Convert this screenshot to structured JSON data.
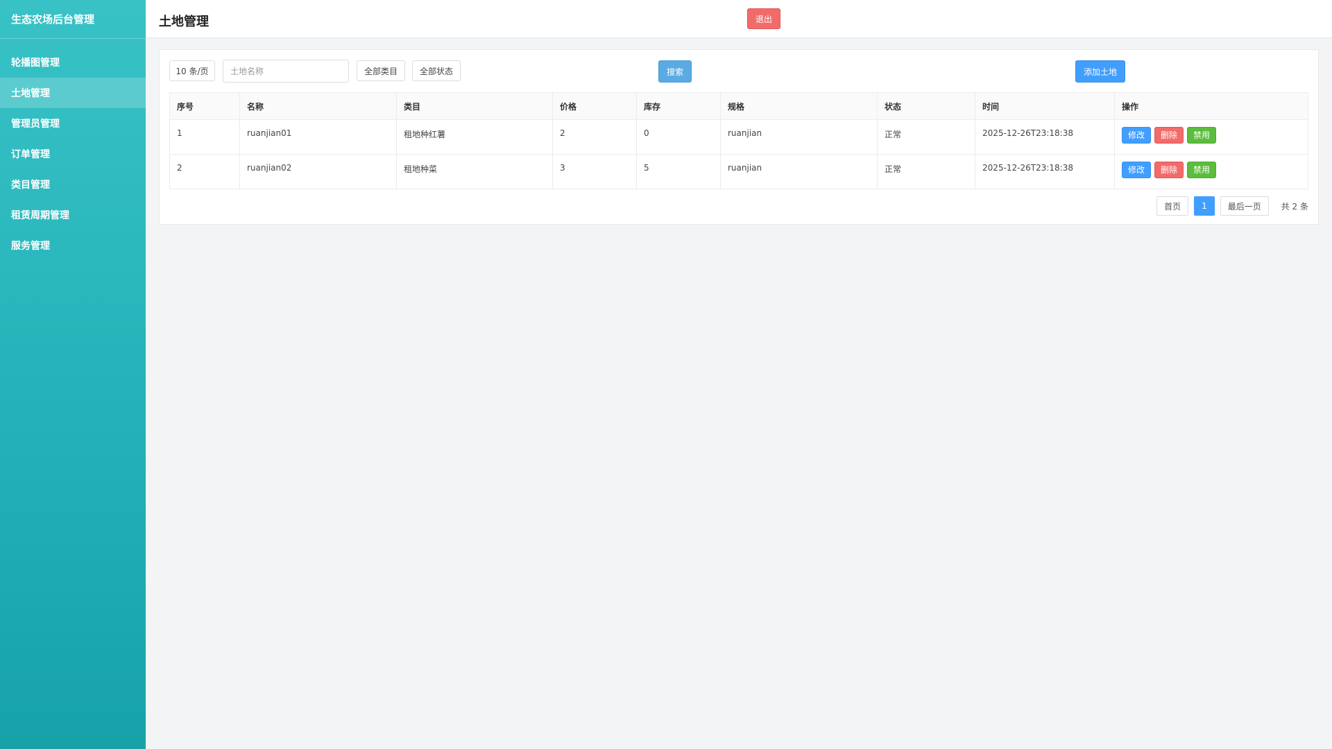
{
  "sidebar": {
    "title": "生态农场后台管理",
    "items": [
      {
        "label": "轮播图管理"
      },
      {
        "label": "土地管理"
      },
      {
        "label": "管理员管理"
      },
      {
        "label": "订单管理"
      },
      {
        "label": "类目管理"
      },
      {
        "label": "租赁周期管理"
      },
      {
        "label": "服务管理"
      }
    ],
    "active_index": 1
  },
  "header": {
    "title": "土地管理",
    "logout_label": "退出"
  },
  "filters": {
    "page_size": "10 条/页",
    "name_placeholder": "土地名称",
    "name_value": "",
    "category": "全部类目",
    "status": "全部状态",
    "search_label": "搜索",
    "add_label": "添加土地"
  },
  "table": {
    "columns": [
      "序号",
      "名称",
      "类目",
      "价格",
      "库存",
      "规格",
      "状态",
      "时间",
      "操作"
    ],
    "rows": [
      {
        "index": "1",
        "name": "ruanjian01",
        "category": "租地种红薯",
        "price": "2",
        "stock": "0",
        "spec": "ruanjian",
        "status": "正常",
        "time": "2025-12-26T23:18:38"
      },
      {
        "index": "2",
        "name": "ruanjian02",
        "category": "租地种菜",
        "price": "3",
        "stock": "5",
        "spec": "ruanjian",
        "status": "正常",
        "time": "2025-12-26T23:18:38"
      }
    ],
    "actions": {
      "edit": "修改",
      "delete": "删除",
      "disable": "禁用"
    }
  },
  "pagination": {
    "first": "首页",
    "current": "1",
    "last": "最后一页",
    "total": "共 2 条"
  },
  "colors": {
    "sidebar_top": "#38c2c6",
    "sidebar_bottom": "#17a2aa",
    "primary": "#409eff",
    "danger": "#f26b6b",
    "success": "#5bbd3c"
  }
}
